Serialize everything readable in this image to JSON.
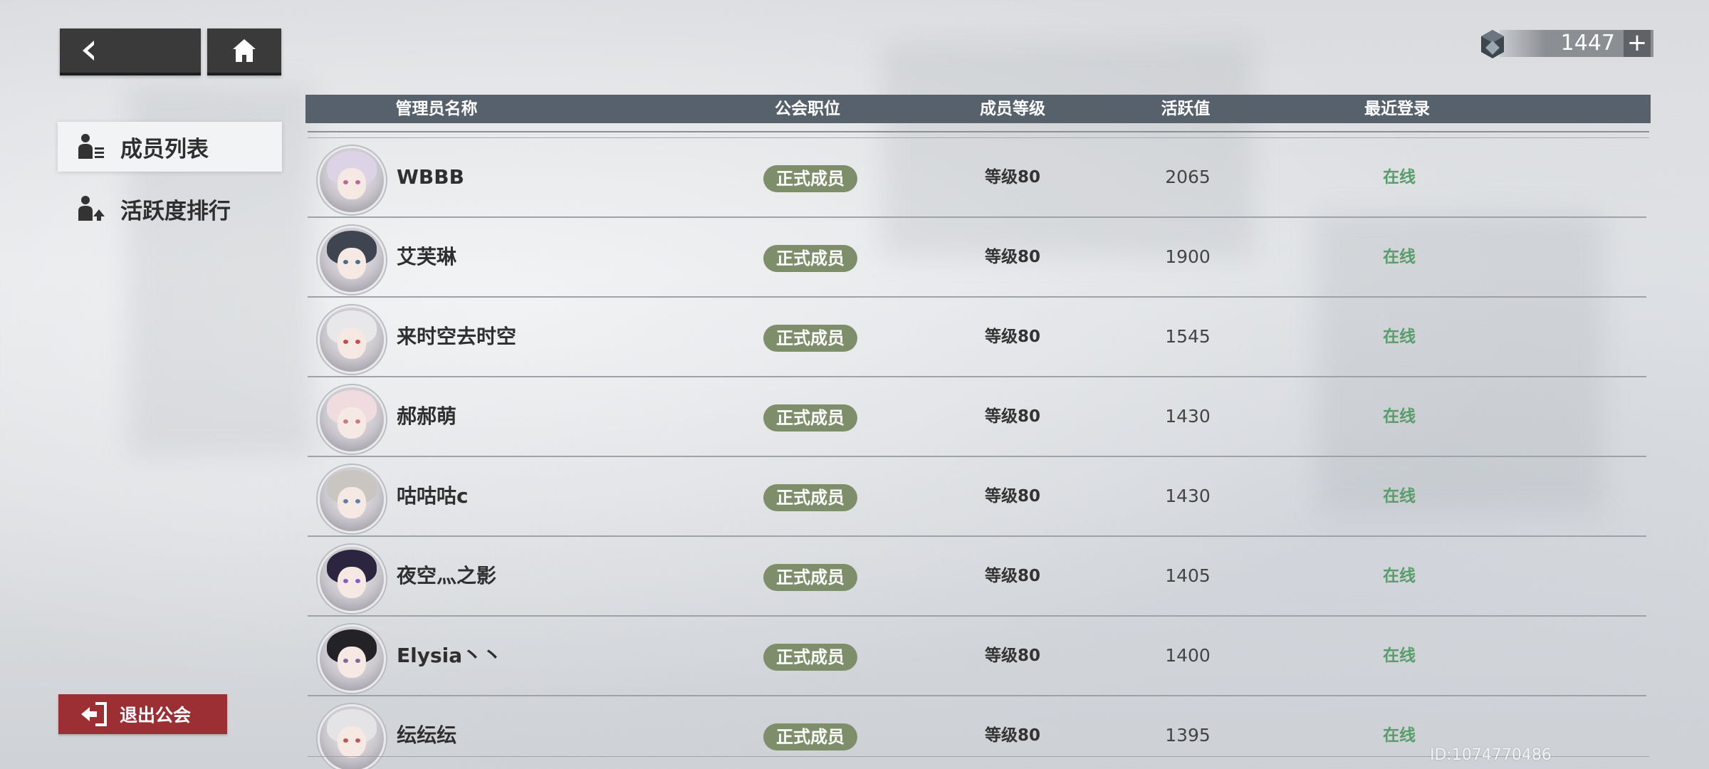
{
  "currency": {
    "icon": "cube-token-icon",
    "value": "1447",
    "add_label": "+"
  },
  "sidebar": {
    "items": [
      {
        "label": "成员列表",
        "icon": "member-list-icon",
        "active": true
      },
      {
        "label": "活跃度排行",
        "icon": "activity-rank-icon",
        "active": false
      }
    ],
    "quit_label": "退出公会"
  },
  "table": {
    "headers": {
      "name": "管理员名称",
      "position": "公会职位",
      "level": "成员等级",
      "activity": "活跃值",
      "last_login": "最近登录"
    },
    "rows": [
      {
        "name": "WBBB",
        "position": "正式成员",
        "level": "等级80",
        "activity": "2065",
        "last_login": "在线"
      },
      {
        "name": "艾芙琳",
        "position": "正式成员",
        "level": "等级80",
        "activity": "1900",
        "last_login": "在线"
      },
      {
        "name": "来时空去时空",
        "position": "正式成员",
        "level": "等级80",
        "activity": "1545",
        "last_login": "在线"
      },
      {
        "name": "郝郝萌",
        "position": "正式成员",
        "level": "等级80",
        "activity": "1430",
        "last_login": "在线"
      },
      {
        "name": "咕咕咕c",
        "position": "正式成员",
        "level": "等级80",
        "activity": "1430",
        "last_login": "在线"
      },
      {
        "name": "夜空灬之影",
        "position": "正式成员",
        "level": "等级80",
        "activity": "1405",
        "last_login": "在线"
      },
      {
        "name": "Elysia丶丶",
        "position": "正式成员",
        "level": "等级80",
        "activity": "1400",
        "last_login": "在线"
      },
      {
        "name": "纭纭纭",
        "position": "正式成员",
        "level": "等级80",
        "activity": "1395",
        "last_login": "在线"
      }
    ]
  },
  "player_id": "ID:1074770486",
  "colors": {
    "header_bg": "#57616c",
    "rank_badge": "#7f8e6a",
    "online": "#5a9d6a",
    "quit_button": "#9c2f33"
  }
}
